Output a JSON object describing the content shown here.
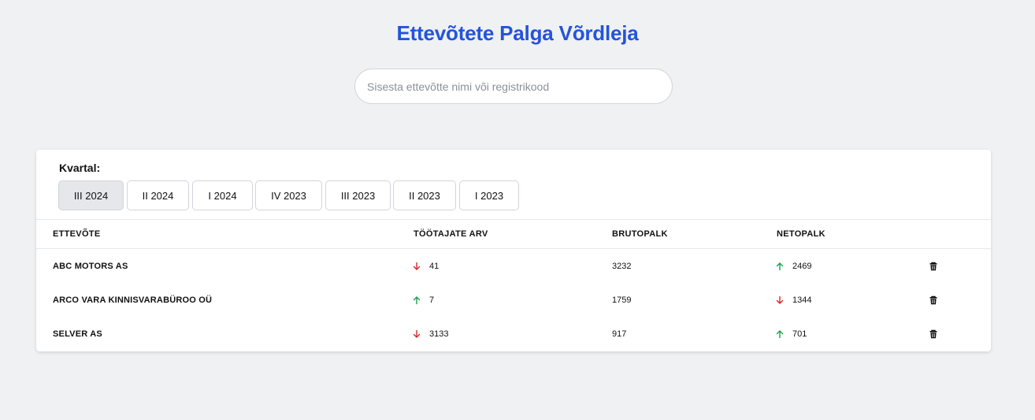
{
  "title": "Ettevõtete Palga Võrdleja",
  "search": {
    "placeholder": "Sisesta ettevõtte nimi või registrikood",
    "value": ""
  },
  "quarter_label": "Kvartal:",
  "quarters": [
    "III 2024",
    "II 2024",
    "I 2024",
    "IV 2023",
    "III 2023",
    "II 2023",
    "I 2023"
  ],
  "selected_quarter": "III 2024",
  "headers": {
    "company": "Ettevõte",
    "employees": "Töötajate arv",
    "gross": "Brutopalk",
    "net": "Netopalk"
  },
  "colors": {
    "accent": "#2254dd",
    "up": "#16a34a",
    "down": "#dc2626"
  },
  "rows": [
    {
      "company": "ABC MOTORS AS",
      "employees": "41",
      "employees_trend": "down",
      "gross": "3232",
      "net": "2469",
      "net_trend": "up"
    },
    {
      "company": "ARCO VARA KINNISVARABÜROO OÜ",
      "employees": "7",
      "employees_trend": "up",
      "gross": "1759",
      "net": "1344",
      "net_trend": "down"
    },
    {
      "company": "SELVER AS",
      "employees": "3133",
      "employees_trend": "down",
      "gross": "917",
      "net": "701",
      "net_trend": "up"
    }
  ]
}
